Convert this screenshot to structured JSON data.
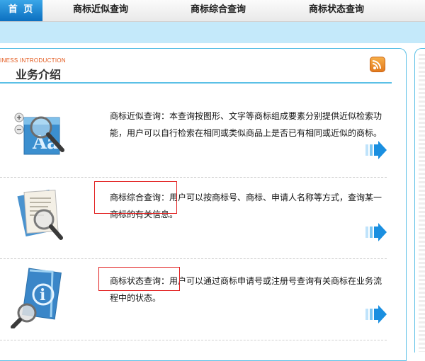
{
  "nav": {
    "home": "首 页",
    "items": [
      "商标近似查询",
      "商标综合查询",
      "商标状态查询"
    ]
  },
  "section": {
    "eng_title": "INESS  INTRODUCTION",
    "title": "业务介绍"
  },
  "services": [
    {
      "text": "商标近似查询：本查询按图形、文字等商标组成要素分别提供近似检索功能，用户可以自行检索在相同或类似商品上是否已有相同或近似的商标。",
      "icon": "magnifier-aa-icon"
    },
    {
      "text": "商标综合查询：用户可以按商标号、商标、申请人名称等方式，查询某一商标的有关信息。",
      "icon": "document-magnifier-icon"
    },
    {
      "text": "商标状态查询：用户可以通过商标申请号或注册号查询有关商标在业务流程中的状态。",
      "icon": "info-book-magnifier-icon"
    }
  ],
  "colors": {
    "accent_blue": "#0b6fc0",
    "band": "#c4e9fa",
    "highlight_red": "#e11b1b",
    "rss_orange": "#f0902e"
  }
}
